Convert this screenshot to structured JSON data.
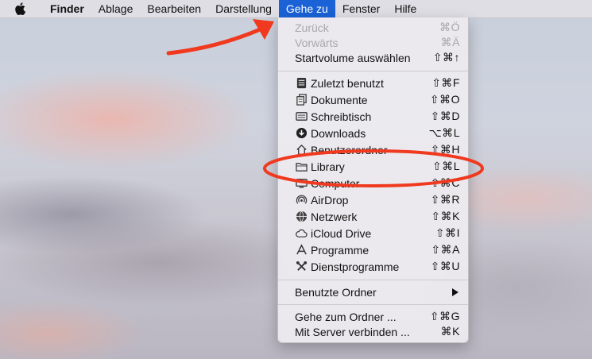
{
  "menubar": {
    "apple_icon": "apple-logo-icon",
    "items": [
      "Finder",
      "Ablage",
      "Bearbeiten",
      "Darstellung",
      "Gehe zu",
      "Fenster",
      "Hilfe"
    ],
    "active_index": 4,
    "bold_index": 0
  },
  "menu": {
    "group1": [
      {
        "label": "Zurück",
        "shortcut": "⌘Ö",
        "disabled": true
      },
      {
        "label": "Vorwärts",
        "shortcut": "⌘Ä",
        "disabled": true
      },
      {
        "label": "Startvolume auswählen",
        "shortcut": "⇧⌘↑",
        "disabled": false
      }
    ],
    "group2": [
      {
        "label": "Zuletzt benutzt",
        "shortcut": "⇧⌘F",
        "icon": "recents-icon"
      },
      {
        "label": "Dokumente",
        "shortcut": "⇧⌘O",
        "icon": "documents-icon"
      },
      {
        "label": "Schreibtisch",
        "shortcut": "⇧⌘D",
        "icon": "desktop-icon"
      },
      {
        "label": "Downloads",
        "shortcut": "⌥⌘L",
        "icon": "downloads-icon"
      },
      {
        "label": "Benutzerordner",
        "shortcut": "⇧⌘H",
        "icon": "home-icon"
      },
      {
        "label": "Library",
        "shortcut": "⇧⌘L",
        "icon": "folder-icon"
      },
      {
        "label": "Computer",
        "shortcut": "⇧⌘C",
        "icon": "computer-icon"
      },
      {
        "label": "AirDrop",
        "shortcut": "⇧⌘R",
        "icon": "airdrop-icon"
      },
      {
        "label": "Netzwerk",
        "shortcut": "⇧⌘K",
        "icon": "network-icon"
      },
      {
        "label": "iCloud Drive",
        "shortcut": "⇧⌘I",
        "icon": "cloud-icon"
      },
      {
        "label": "Programme",
        "shortcut": "⇧⌘A",
        "icon": "applications-icon"
      },
      {
        "label": "Dienstprogramme",
        "shortcut": "⇧⌘U",
        "icon": "utilities-icon"
      }
    ],
    "group3": [
      {
        "label": "Benutzte Ordner",
        "submenu": true
      }
    ],
    "group4": [
      {
        "label": "Gehe zum Ordner ...",
        "shortcut": "⇧⌘G"
      },
      {
        "label": "Mit Server verbinden ...",
        "shortcut": "⌘K"
      }
    ]
  },
  "annotations": {
    "arrow_color": "#f0391f",
    "ellipse_color": "#f0391f",
    "highlighted_item": "Library"
  },
  "colors": {
    "menubar_active": "#1a62d6",
    "menu_bg": "#eceaee",
    "disabled_text": "#a9a6ad"
  }
}
